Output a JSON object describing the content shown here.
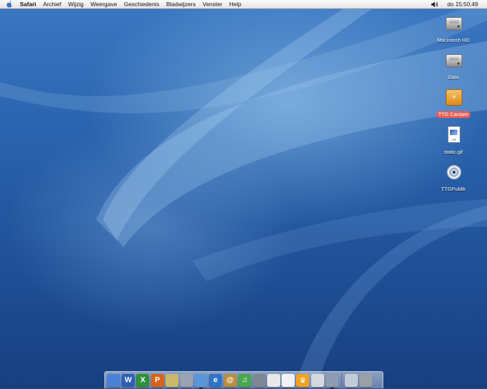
{
  "menubar": {
    "apple_icon": "apple-icon",
    "app_name": "Safari",
    "menus": [
      "Archief",
      "Wijzig",
      "Weergave",
      "Geschiedenis",
      "Bladwijzers",
      "Venster",
      "Help"
    ],
    "volume_icon": "speaker-icon",
    "clock": "do 15:50:49"
  },
  "desktop_icons": [
    {
      "label": "Macintosh HD",
      "icon": "hard-drive-icon",
      "selected": false
    },
    {
      "label": "Data",
      "icon": "hard-drive-icon",
      "selected": false
    },
    {
      "label": "TTG Cantare",
      "icon": "firewire-drive-icon",
      "selected": true
    },
    {
      "label": "static.gif",
      "icon": "gif-file-icon",
      "selected": false
    },
    {
      "label": "TTGPublik",
      "icon": "network-volume-icon",
      "selected": false
    }
  ],
  "dock": {
    "apps": [
      {
        "name": "finder-icon",
        "letter": "",
        "color": "#4a82d6"
      },
      {
        "name": "word-icon",
        "letter": "W",
        "color": "#2d5fb8"
      },
      {
        "name": "excel-icon",
        "letter": "X",
        "color": "#2f8f3a"
      },
      {
        "name": "powerpoint-icon",
        "letter": "P",
        "color": "#d8641c"
      },
      {
        "name": "pencil-app-icon",
        "letter": "",
        "color": "#c9b86a"
      },
      {
        "name": "preview-icon",
        "letter": "",
        "color": "#9aa3b2"
      },
      {
        "name": "safari-icon",
        "letter": "",
        "color": "#5a97d8"
      },
      {
        "name": "internet-explorer-icon",
        "letter": "e",
        "color": "#2f74c6"
      },
      {
        "name": "address-book-icon",
        "letter": "@",
        "color": "#b88f3e"
      },
      {
        "name": "itunes-icon",
        "letter": "♫",
        "color": "#4aa64f"
      },
      {
        "name": "iphoto-icon",
        "letter": "",
        "color": "#7e8794"
      },
      {
        "name": "textedit-icon",
        "letter": "",
        "color": "#e8e8e8"
      },
      {
        "name": "ical-icon",
        "letter": "",
        "color": "#f2f2f2"
      },
      {
        "name": "ttg-app-icon",
        "letter": "♛",
        "color": "#f1a21f"
      },
      {
        "name": "printer-icon",
        "letter": "",
        "color": "#d5d8de"
      },
      {
        "name": "system-preferences-icon",
        "letter": "",
        "color": "#8e9bb1"
      }
    ],
    "right_items": [
      {
        "name": "minimized-window-icon",
        "color": "#c3ccd9"
      },
      {
        "name": "trash-icon",
        "color": "#9aa0a8"
      }
    ]
  }
}
